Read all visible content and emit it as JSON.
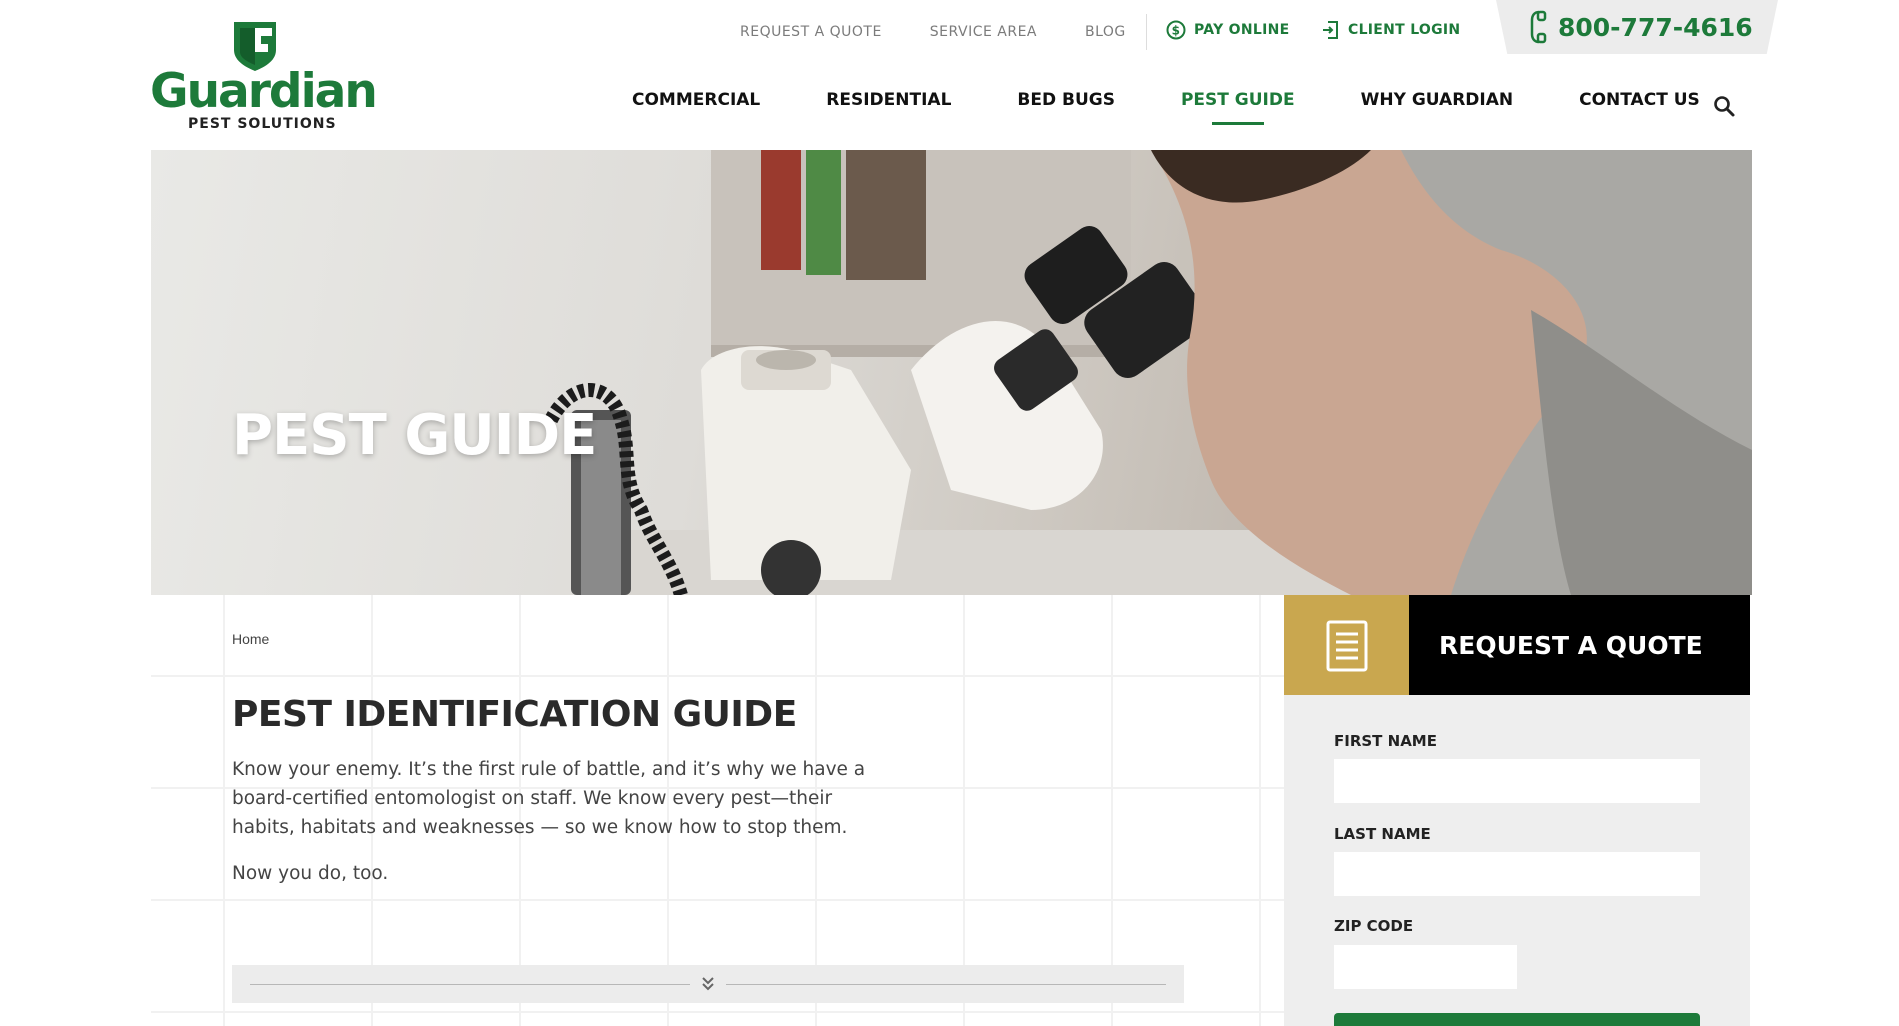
{
  "logo": {
    "name": "Guardian",
    "tagline": "PEST SOLUTIONS"
  },
  "utility_nav": {
    "links": [
      "REQUEST A QUOTE",
      "SERVICE AREA",
      "BLOG"
    ],
    "pay_online": "PAY ONLINE",
    "client_login": "CLIENT LOGIN",
    "phone": "800-777-4616"
  },
  "main_nav": {
    "items": [
      "COMMERCIAL",
      "RESIDENTIAL",
      "BED BUGS",
      "PEST GUIDE",
      "WHY GUARDIAN",
      "CONTACT US"
    ],
    "active": "PEST GUIDE",
    "search_icon": "search-icon"
  },
  "hero": {
    "title": "PEST GUIDE"
  },
  "content": {
    "breadcrumb": "Home",
    "heading": "PEST IDENTIFICATION GUIDE",
    "intro": "Know your enemy. It’s the first rule of battle, and it’s why we have a board-certified entomologist on staff. We know every pest—their habits, habitats and weaknesses — so we know how to stop them.",
    "intro_2": "Now you do, too.",
    "expand_icon": "double-chevron-down-icon"
  },
  "quote_form": {
    "title": "REQUEST A QUOTE",
    "icon": "document-icon",
    "fields": [
      {
        "label": "FIRST NAME",
        "value": ""
      },
      {
        "label": "LAST NAME",
        "value": ""
      },
      {
        "label": "ZIP CODE",
        "value": ""
      }
    ]
  },
  "colors": {
    "brand_green": "#1d7a3a",
    "gold": "#c9a74f",
    "black": "#000000",
    "form_bg": "#eeeeee"
  }
}
